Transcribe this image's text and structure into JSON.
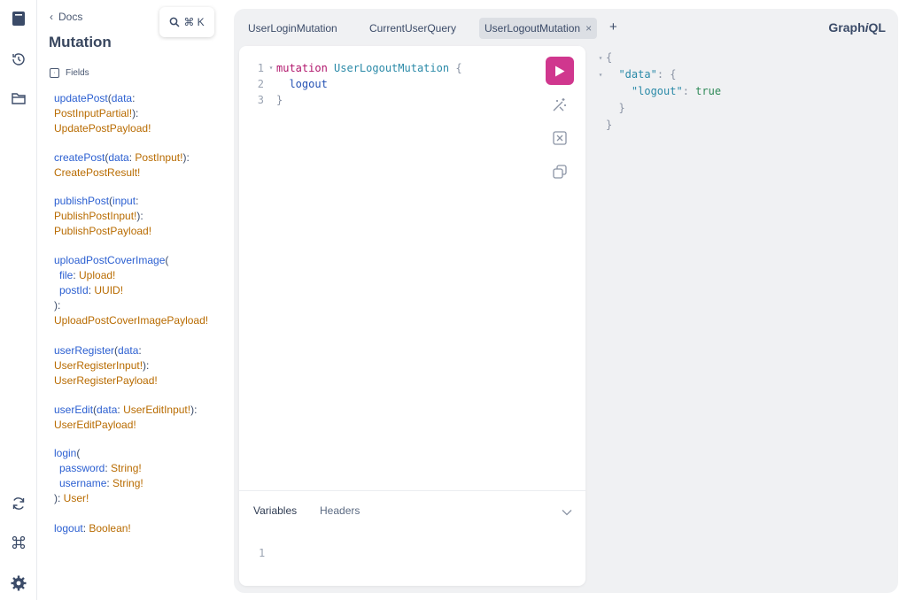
{
  "docs": {
    "back_label": "Docs",
    "title": "Mutation",
    "search_shortcut": "⌘ K",
    "fields_label": "Fields",
    "fields": [
      {
        "name": "updatePost",
        "arg": "data",
        "arg_type": "PostInputPartial!",
        "return_type": "UpdatePostPayload!"
      },
      {
        "name": "createPost",
        "arg": "data",
        "arg_type": "PostInput!",
        "return_type": "CreatePostResult!"
      },
      {
        "name": "publishPost",
        "arg": "input",
        "arg_type": "PublishPostInput!",
        "return_type": "PublishPostPayload!"
      },
      {
        "name": "uploadPostCoverImage",
        "arg1": "file",
        "arg1_type": "Upload!",
        "arg2": "postId",
        "arg2_type": "UUID!",
        "return_type": "UploadPostCoverImagePayload!"
      },
      {
        "name": "userRegister",
        "arg": "data",
        "arg_type": "UserRegisterInput!",
        "return_type": "UserRegisterPayload!"
      },
      {
        "name": "userEdit",
        "arg": "data",
        "arg_type": "UserEditInput!",
        "return_type": "UserEditPayload!"
      },
      {
        "name": "login",
        "arg1": "password",
        "arg1_type": "String!",
        "arg2": "username",
        "arg2_type": "String!",
        "return_type": "User!"
      },
      {
        "name": "logout",
        "return_type": "Boolean!"
      }
    ]
  },
  "tabs": [
    {
      "label": "UserLoginMutation"
    },
    {
      "label": "CurrentUserQuery"
    },
    {
      "label": "UserLogoutMutation",
      "active": true
    }
  ],
  "brand": {
    "prefix": "Graph",
    "italic": "i",
    "suffix": "QL"
  },
  "editor": {
    "line_numbers": [
      "1",
      "2",
      "3"
    ],
    "keyword": "mutation",
    "operation_name": "UserLogoutMutation",
    "open_brace": "{",
    "field": "logout",
    "close_brace": "}"
  },
  "bottom_tabs": {
    "variables": "Variables",
    "headers": "Headers"
  },
  "variables_line_number": "1",
  "result": {
    "open": "{",
    "data_key": "\"data\"",
    "colon": ": ",
    "inner_open": "{",
    "logout_key": "\"logout\"",
    "logout_value": "true",
    "inner_close": "}",
    "close": "}"
  },
  "colors": {
    "run_button": "#d0378e",
    "field_name": "#2b5fd1",
    "type_name": "#b86b00"
  },
  "icons": [
    "docs-icon",
    "history-icon",
    "explorer-icon",
    "refresh-icon",
    "command-icon",
    "settings-icon",
    "run-icon",
    "prettify-icon",
    "merge-icon",
    "copy-icon"
  ]
}
